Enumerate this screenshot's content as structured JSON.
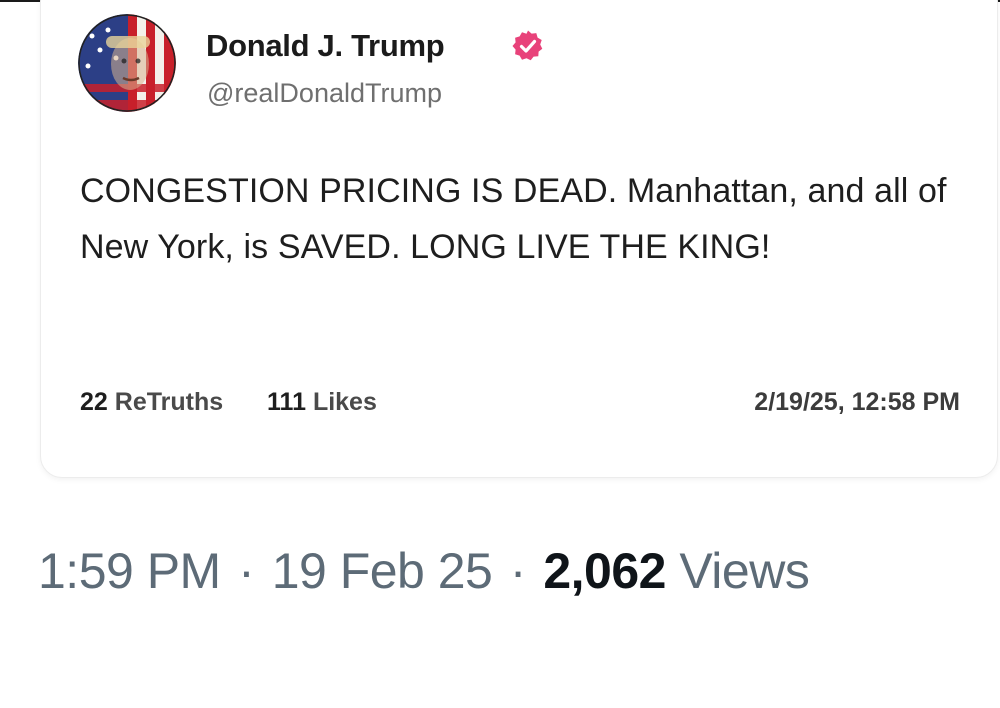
{
  "post": {
    "author": {
      "display_name": "Donald J. Trump",
      "handle": "@realDonaldTrump",
      "verified": true,
      "verified_color": "#e8427a",
      "avatar": "flag-portrait-avatar"
    },
    "text": "CONGESTION PRICING IS DEAD. Manhattan, and all of New York, is SAVED. LONG LIVE THE KING!",
    "stats": {
      "retruths_count": "22",
      "retruths_label": "ReTruths",
      "likes_count": "111",
      "likes_label": "Likes"
    },
    "timestamp": "2/19/25, 12:58 PM"
  },
  "tweet_meta": {
    "time": "1:59 PM",
    "separator": "·",
    "date": "19 Feb 25",
    "views_count": "2,062",
    "views_label": "Views"
  },
  "colors": {
    "text_primary": "#1e1e1e",
    "text_secondary": "#6f6f6f",
    "meta_gray": "#5d6b77"
  }
}
